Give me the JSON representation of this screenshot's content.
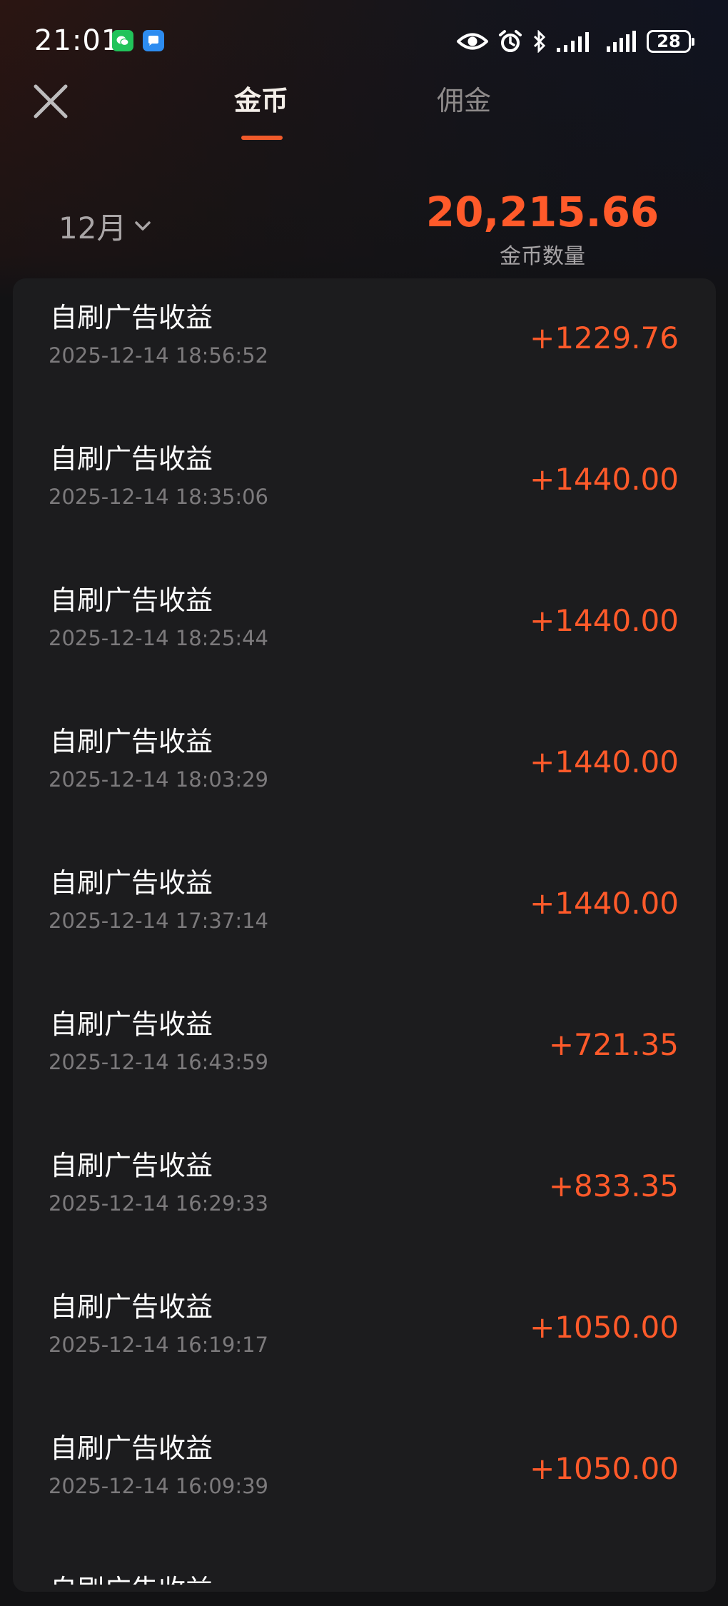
{
  "status_bar": {
    "time": "21:01",
    "battery": "28"
  },
  "header": {
    "tabs": [
      {
        "label": "金币",
        "active": true
      },
      {
        "label": "佣金",
        "active": false
      }
    ]
  },
  "summary": {
    "month": "12月",
    "total": "20,215.66",
    "caption": "金币数量"
  },
  "records": [
    {
      "title": "自刷广告收益",
      "time": "2025-12-14 18:56:52",
      "amount": "+1229.76"
    },
    {
      "title": "自刷广告收益",
      "time": "2025-12-14 18:35:06",
      "amount": "+1440.00"
    },
    {
      "title": "自刷广告收益",
      "time": "2025-12-14 18:25:44",
      "amount": "+1440.00"
    },
    {
      "title": "自刷广告收益",
      "time": "2025-12-14 18:03:29",
      "amount": "+1440.00"
    },
    {
      "title": "自刷广告收益",
      "time": "2025-12-14 17:37:14",
      "amount": "+1440.00"
    },
    {
      "title": "自刷广告收益",
      "time": "2025-12-14 16:43:59",
      "amount": "+721.35"
    },
    {
      "title": "自刷广告收益",
      "time": "2025-12-14 16:29:33",
      "amount": "+833.35"
    },
    {
      "title": "自刷广告收益",
      "time": "2025-12-14 16:19:17",
      "amount": "+1050.00"
    },
    {
      "title": "自刷广告收益",
      "time": "2025-12-14 16:09:39",
      "amount": "+1050.00"
    }
  ],
  "partial_record": {
    "title": "自刷广告收益"
  },
  "colors": {
    "accent": "#ff5a2a",
    "tab_indicator": "#f05a2a",
    "list_background": "#1c1c1e",
    "wechat_badge": "#21c35a",
    "message_badge": "#2d8cf0"
  },
  "icons": {
    "status": [
      "wechat-icon",
      "message-icon",
      "eye-icon",
      "alarm-icon",
      "bluetooth-icon",
      "signal-icon",
      "signal-icon",
      "battery-icon"
    ],
    "header": [
      "close-icon"
    ],
    "month_selector": [
      "chevron-down-icon"
    ]
  }
}
